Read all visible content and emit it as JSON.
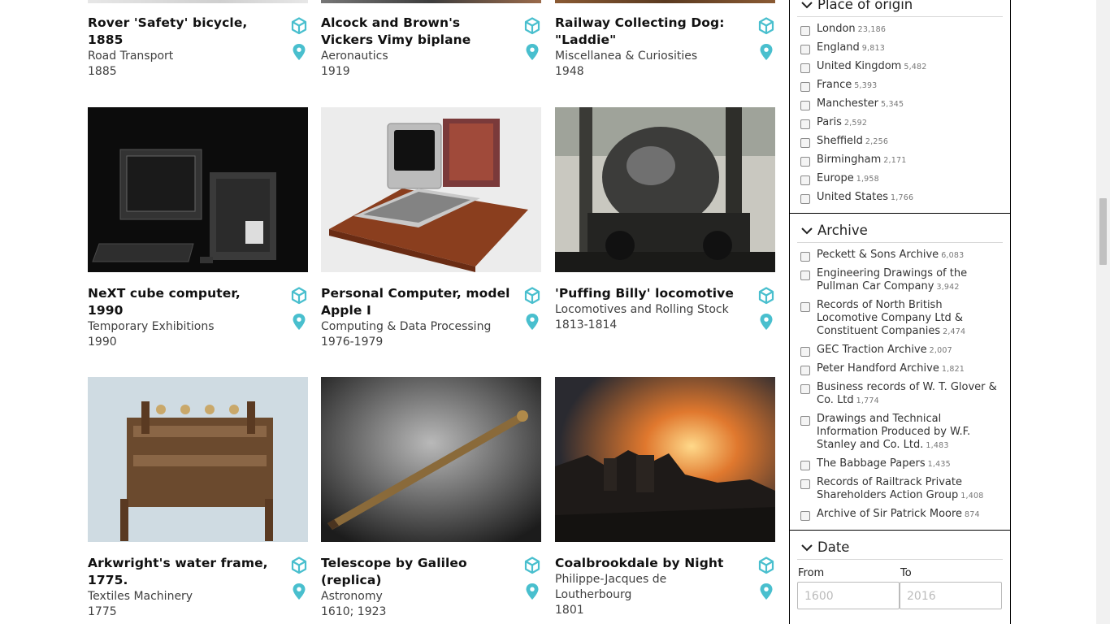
{
  "results": [
    {
      "title": "Rover 'Safety' bicycle, 1885",
      "category": "Road Transport",
      "date": "1885"
    },
    {
      "title": "Alcock and Brown's Vickers Vimy biplane",
      "category": "Aeronautics",
      "date": "1919"
    },
    {
      "title": "Railway Collecting Dog: \"Laddie\"",
      "category": "Miscellanea & Curiosities",
      "date": "1948"
    },
    {
      "title": "NeXT cube computer, 1990",
      "category": "Temporary Exhibitions",
      "date": "1990"
    },
    {
      "title": "Personal Computer, model Apple I",
      "category": "Computing & Data Processing",
      "date": "1976-1979"
    },
    {
      "title": "'Puffing Billy' locomotive",
      "category": "Locomotives and Rolling Stock",
      "date": "1813-1814"
    },
    {
      "title": "Arkwright's water frame, 1775.",
      "category": "Textiles Machinery",
      "date": "1775"
    },
    {
      "title": "Telescope by Galileo (replica)",
      "category": "Astronomy",
      "date": "1610; 1923"
    },
    {
      "title": "Coalbrookdale by Night",
      "category": "Philippe-Jacques de Loutherbourg",
      "date": "1801"
    }
  ],
  "filters": {
    "place_of_origin": {
      "label": "Place of origin",
      "options": [
        {
          "label": "London",
          "count": "23,186"
        },
        {
          "label": "England",
          "count": "9,813"
        },
        {
          "label": "United Kingdom",
          "count": "5,482"
        },
        {
          "label": "France",
          "count": "5,393"
        },
        {
          "label": "Manchester",
          "count": "5,345"
        },
        {
          "label": "Paris",
          "count": "2,592"
        },
        {
          "label": "Sheffield",
          "count": "2,256"
        },
        {
          "label": "Birmingham",
          "count": "2,171"
        },
        {
          "label": "Europe",
          "count": "1,958"
        },
        {
          "label": "United States",
          "count": "1,766"
        }
      ]
    },
    "archive": {
      "label": "Archive",
      "options": [
        {
          "label": "Peckett & Sons Archive",
          "count": "6,083"
        },
        {
          "label": "Engineering Drawings of the Pullman Car Company",
          "count": "3,942"
        },
        {
          "label": "Records of North British Locomotive Company Ltd & Constituent Companies",
          "count": "2,474"
        },
        {
          "label": "GEC Traction Archive",
          "count": "2,007"
        },
        {
          "label": "Peter Handford Archive",
          "count": "1,821"
        },
        {
          "label": "Business records of W. T. Glover & Co. Ltd",
          "count": "1,774"
        },
        {
          "label": "Drawings and Technical Information Produced by W.F. Stanley and Co. Ltd.",
          "count": "1,483"
        },
        {
          "label": "The Babbage Papers",
          "count": "1,435"
        },
        {
          "label": "Records of Railtrack Private Shareholders Action Group",
          "count": "1,408"
        },
        {
          "label": "Archive of Sir Patrick Moore",
          "count": "874"
        }
      ]
    },
    "date": {
      "label": "Date",
      "from_label": "From",
      "to_label": "To",
      "from_placeholder": "1600",
      "to_placeholder": "2016"
    }
  },
  "icons": {
    "card_3d": "cube-icon",
    "card_location": "map-pin-icon",
    "facet_toggle": "chevron-down-icon"
  },
  "colors": {
    "accent": "#49bfce",
    "text": "#111111",
    "muted": "#3f3f3f",
    "count": "#777777"
  }
}
